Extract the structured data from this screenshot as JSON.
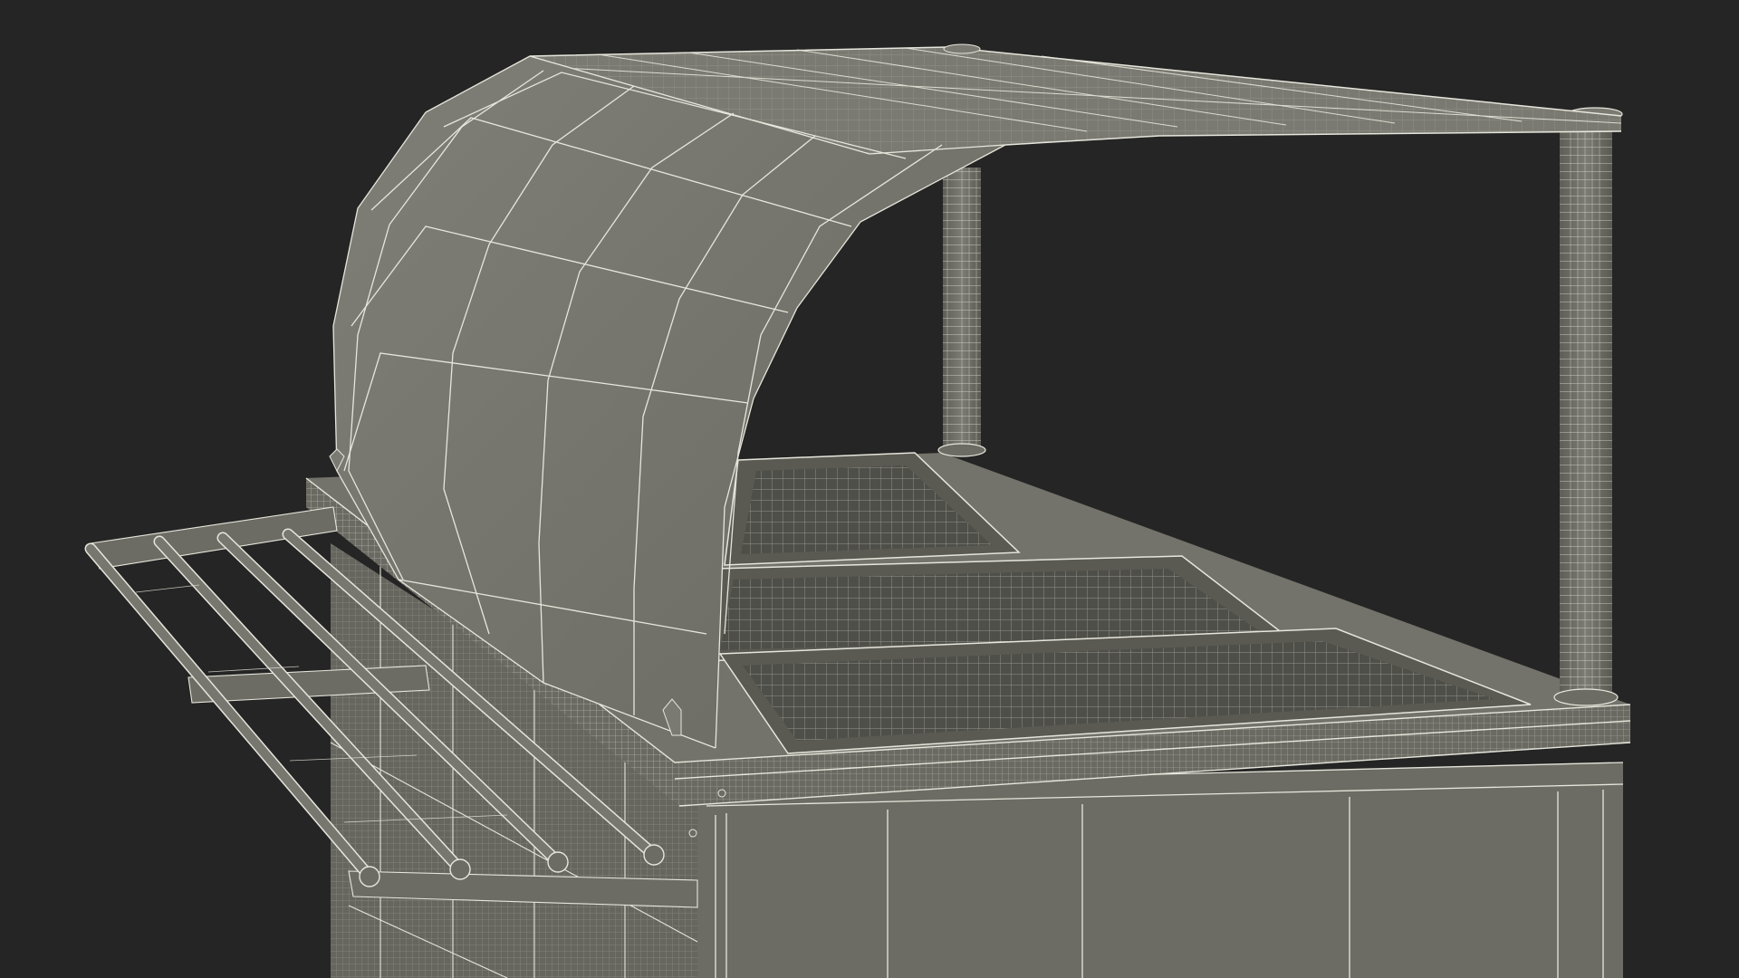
{
  "scene": {
    "subject": "wireframe-render-food-bar-cart",
    "render_style": "wireframe",
    "colors": {
      "background": "#252525",
      "surface_light": "#7b7b73",
      "surface_mid": "#6c6c64",
      "surface_dark": "#55554e",
      "shadow": "#3e3e39",
      "wire": "#e6e6dc",
      "wire_dim": "#c9c9be"
    }
  }
}
